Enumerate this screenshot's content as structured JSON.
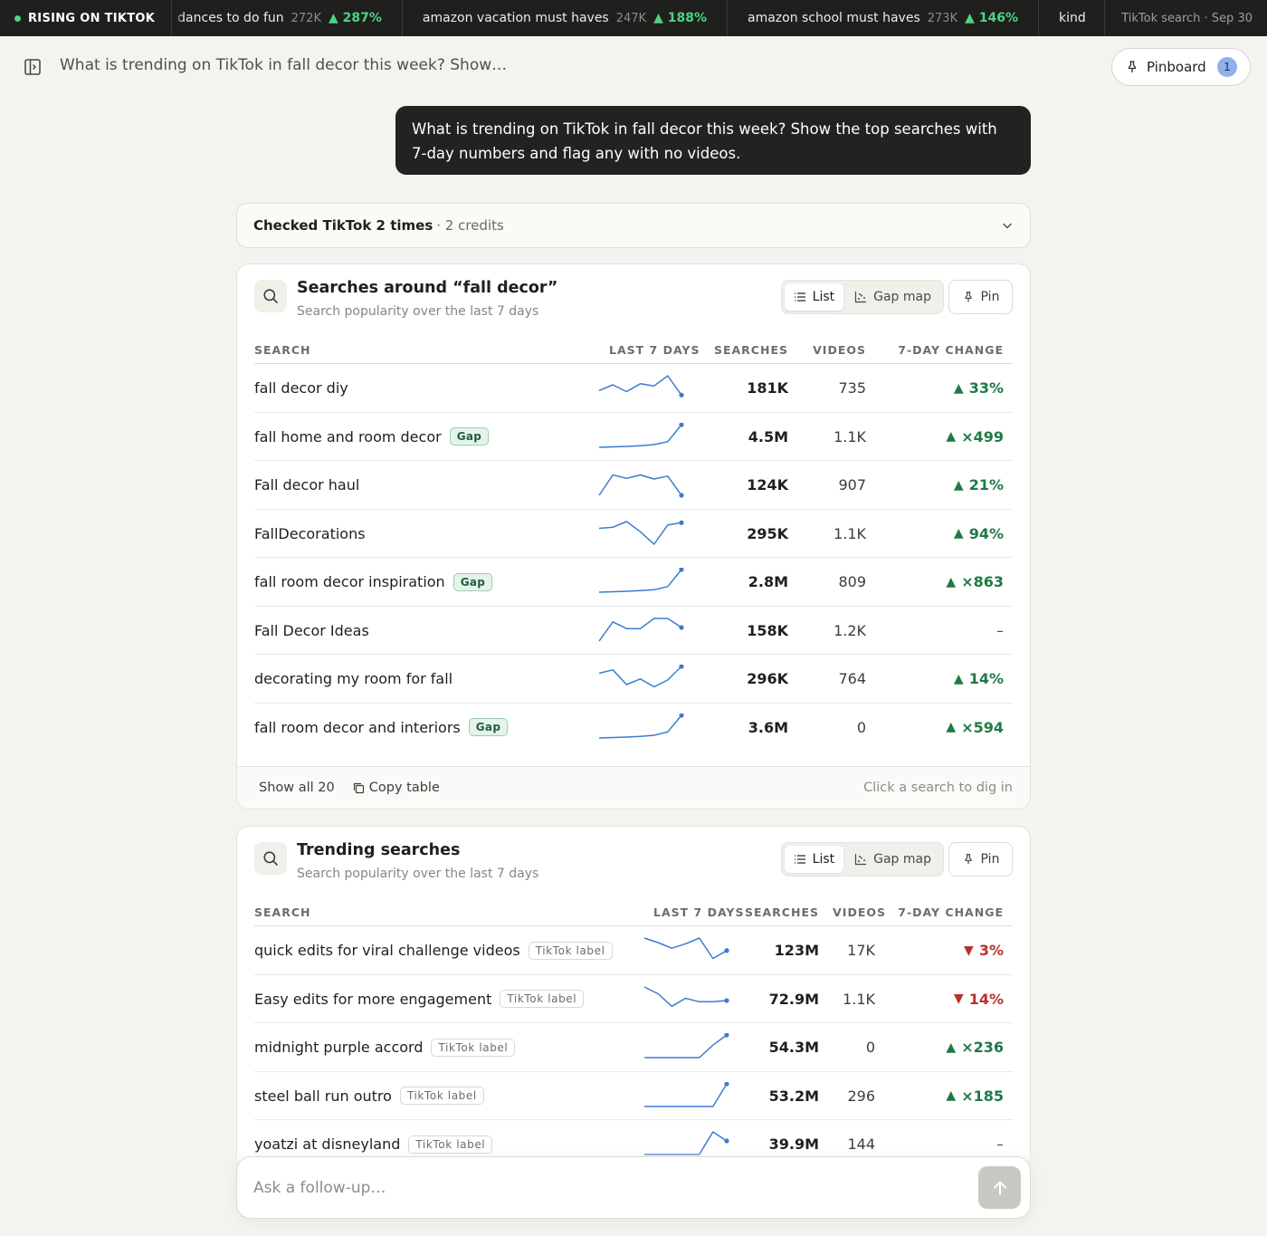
{
  "ticker": {
    "label": "RISING ON TIKTOK",
    "items": [
      {
        "name": "dances to do fun",
        "value": "272K",
        "change": "▲ 287%"
      },
      {
        "name": "amazon vacation must haves",
        "value": "247K",
        "change": "▲ 188%"
      },
      {
        "name": "amazon school must haves",
        "value": "273K",
        "change": "▲ 146%"
      },
      {
        "name": "kind",
        "value": "",
        "change": ""
      }
    ],
    "source": "TikTok search · Sep 30"
  },
  "header": {
    "title": "What is trending on TikTok in fall decor this week? Show…",
    "pinboard_label": "Pinboard",
    "pinboard_count": "1"
  },
  "user_message": "What is trending on TikTok in fall decor this week? Show the top searches with 7-day numbers and flag any with no videos.",
  "checked": {
    "label": "Checked TikTok 2 times",
    "credits": "· 2 credits"
  },
  "columns": {
    "search": "SEARCH",
    "last7": "LAST 7 DAYS",
    "searches": "SEARCHES",
    "videos": "VIDEOS",
    "change": "7-DAY CHANGE"
  },
  "controls": {
    "list": "List",
    "gap_map": "Gap map",
    "pin": "Pin"
  },
  "card1": {
    "title": "Searches around “fall decor”",
    "subtitle": "Search popularity over the last 7 days",
    "rows": [
      {
        "name": "fall decor diy",
        "tag": "",
        "searches": "181K",
        "videos": "735",
        "change": "33%",
        "dir": "up",
        "spark": [
          0.35,
          0.6,
          0.3,
          0.65,
          0.55,
          1.0,
          0.15
        ]
      },
      {
        "name": "fall home and room decor",
        "tag": "Gap",
        "searches": "4.5M",
        "videos": "1.1K",
        "change": "×499",
        "dir": "up",
        "spark": [
          0.0,
          0.02,
          0.04,
          0.07,
          0.12,
          0.25,
          1.0
        ]
      },
      {
        "name": "Fall decor haul",
        "tag": "",
        "searches": "124K",
        "videos": "907",
        "change": "21%",
        "dir": "up",
        "spark": [
          0.0,
          0.9,
          0.75,
          0.9,
          0.72,
          0.85,
          0.0
        ]
      },
      {
        "name": "FallDecorations",
        "tag": "",
        "searches": "295K",
        "videos": "1.1K",
        "change": "94%",
        "dir": "up",
        "spark": [
          0.7,
          0.75,
          1.0,
          0.55,
          0.0,
          0.85,
          0.95
        ]
      },
      {
        "name": "fall room decor inspiration",
        "tag": "Gap",
        "searches": "2.8M",
        "videos": "809",
        "change": "×863",
        "dir": "up",
        "spark": [
          0.0,
          0.02,
          0.04,
          0.07,
          0.11,
          0.25,
          1.0
        ]
      },
      {
        "name": "Fall Decor Ideas",
        "tag": "",
        "searches": "158K",
        "videos": "1.2K",
        "change": "–",
        "dir": "flat",
        "spark": [
          0.0,
          0.85,
          0.55,
          0.55,
          1.0,
          1.0,
          0.6
        ]
      },
      {
        "name": "decorating my room for fall",
        "tag": "",
        "searches": "296K",
        "videos": "764",
        "change": "14%",
        "dir": "up",
        "spark": [
          0.7,
          0.85,
          0.2,
          0.45,
          0.1,
          0.4,
          1.0
        ]
      },
      {
        "name": "fall room decor and interiors",
        "tag": "Gap",
        "searches": "3.6M",
        "videos": "0",
        "change": "×594",
        "dir": "up",
        "spark": [
          0.0,
          0.02,
          0.04,
          0.07,
          0.12,
          0.27,
          1.0
        ]
      }
    ],
    "footer": {
      "show_all": "Show all 20",
      "copy": "Copy table",
      "hint": "Click a search to dig in"
    }
  },
  "card2": {
    "title": "Trending searches",
    "subtitle": "Search popularity over the last 7 days",
    "rows": [
      {
        "name": "quick edits for viral challenge videos",
        "tag": "TikTok label",
        "searches": "123M",
        "videos": "17K",
        "change": "3%",
        "dir": "down",
        "spark": [
          1.0,
          0.8,
          0.55,
          0.75,
          1.0,
          0.1,
          0.45
        ]
      },
      {
        "name": "Easy edits for more engagement",
        "tag": "TikTok label",
        "searches": "72.9M",
        "videos": "1.1K",
        "change": "14%",
        "dir": "down",
        "spark": [
          1.0,
          0.7,
          0.15,
          0.5,
          0.35,
          0.35,
          0.4
        ]
      },
      {
        "name": "midnight purple accord",
        "tag": "TikTok label",
        "searches": "54.3M",
        "videos": "0",
        "change": "×236",
        "dir": "up",
        "spark": [
          0.0,
          0.0,
          0.0,
          0.0,
          0.0,
          0.55,
          1.0
        ]
      },
      {
        "name": "steel ball run outro",
        "tag": "TikTok label",
        "searches": "53.2M",
        "videos": "296",
        "change": "×185",
        "dir": "up",
        "spark": [
          0.0,
          0.0,
          0.0,
          0.0,
          0.0,
          0.0,
          1.0
        ]
      },
      {
        "name": "yoatzi at disneyland",
        "tag": "TikTok label",
        "searches": "39.9M",
        "videos": "144",
        "change": "–",
        "dir": "flat",
        "spark": [
          0.0,
          0.0,
          0.0,
          0.0,
          0.0,
          1.0,
          0.6
        ]
      }
    ]
  },
  "composer": {
    "placeholder": "Ask a follow-up…"
  },
  "colors": {
    "up": "#1e7a46",
    "down": "#b8312c",
    "sparkline": "#3b7bd1",
    "ticker_up": "#4cd384"
  }
}
